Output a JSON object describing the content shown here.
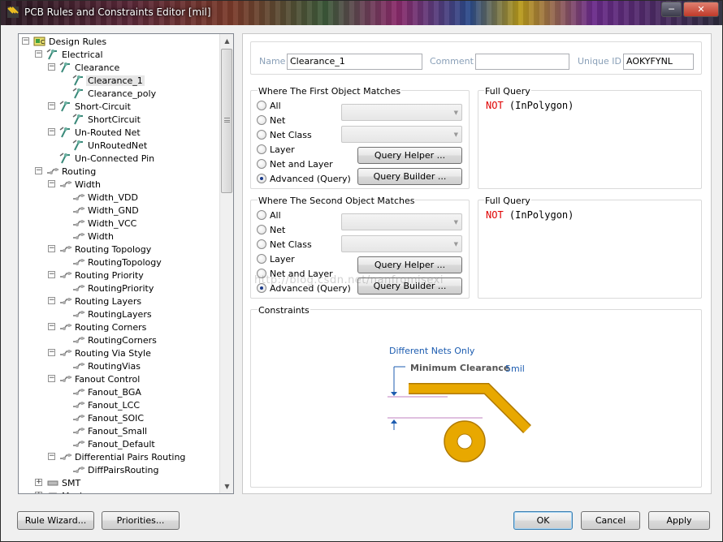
{
  "window": {
    "title": "PCB Rules and Constraints Editor [mil]",
    "minimize_glyph": "─",
    "close_glyph": "✕"
  },
  "tree": {
    "rows": [
      {
        "label": "Design Rules",
        "level": 0,
        "expander": "−",
        "icon": "design-rules-icon"
      },
      {
        "label": "Electrical",
        "level": 1,
        "expander": "−",
        "icon": "electrical-rule-icon"
      },
      {
        "label": "Clearance",
        "level": 2,
        "expander": "−",
        "icon": "electrical-rule-icon"
      },
      {
        "label": "Clearance_1",
        "level": 3,
        "expander": "",
        "icon": "electrical-rule-icon",
        "selected": true
      },
      {
        "label": "Clearance_poly",
        "level": 3,
        "expander": "",
        "icon": "electrical-rule-icon"
      },
      {
        "label": "Short-Circuit",
        "level": 2,
        "expander": "−",
        "icon": "electrical-rule-icon"
      },
      {
        "label": "ShortCircuit",
        "level": 3,
        "expander": "",
        "icon": "electrical-rule-icon"
      },
      {
        "label": "Un-Routed Net",
        "level": 2,
        "expander": "−",
        "icon": "electrical-rule-icon"
      },
      {
        "label": "UnRoutedNet",
        "level": 3,
        "expander": "",
        "icon": "electrical-rule-icon"
      },
      {
        "label": "Un-Connected Pin",
        "level": 2,
        "expander": "",
        "icon": "electrical-rule-icon"
      },
      {
        "label": "Routing",
        "level": 1,
        "expander": "−",
        "icon": "routing-rule-icon"
      },
      {
        "label": "Width",
        "level": 2,
        "expander": "−",
        "icon": "routing-rule-icon"
      },
      {
        "label": "Width_VDD",
        "level": 3,
        "expander": "",
        "icon": "routing-rule-icon"
      },
      {
        "label": "Width_GND",
        "level": 3,
        "expander": "",
        "icon": "routing-rule-icon"
      },
      {
        "label": "Width_VCC",
        "level": 3,
        "expander": "",
        "icon": "routing-rule-icon"
      },
      {
        "label": "Width",
        "level": 3,
        "expander": "",
        "icon": "routing-rule-icon"
      },
      {
        "label": "Routing Topology",
        "level": 2,
        "expander": "−",
        "icon": "routing-rule-icon"
      },
      {
        "label": "RoutingTopology",
        "level": 3,
        "expander": "",
        "icon": "routing-rule-icon"
      },
      {
        "label": "Routing Priority",
        "level": 2,
        "expander": "−",
        "icon": "routing-rule-icon"
      },
      {
        "label": "RoutingPriority",
        "level": 3,
        "expander": "",
        "icon": "routing-rule-icon"
      },
      {
        "label": "Routing Layers",
        "level": 2,
        "expander": "−",
        "icon": "routing-rule-icon"
      },
      {
        "label": "RoutingLayers",
        "level": 3,
        "expander": "",
        "icon": "routing-rule-icon"
      },
      {
        "label": "Routing Corners",
        "level": 2,
        "expander": "−",
        "icon": "routing-rule-icon"
      },
      {
        "label": "RoutingCorners",
        "level": 3,
        "expander": "",
        "icon": "routing-rule-icon"
      },
      {
        "label": "Routing Via Style",
        "level": 2,
        "expander": "−",
        "icon": "routing-rule-icon"
      },
      {
        "label": "RoutingVias",
        "level": 3,
        "expander": "",
        "icon": "routing-rule-icon"
      },
      {
        "label": "Fanout Control",
        "level": 2,
        "expander": "−",
        "icon": "routing-rule-icon"
      },
      {
        "label": "Fanout_BGA",
        "level": 3,
        "expander": "",
        "icon": "routing-rule-icon"
      },
      {
        "label": "Fanout_LCC",
        "level": 3,
        "expander": "",
        "icon": "routing-rule-icon"
      },
      {
        "label": "Fanout_SOIC",
        "level": 3,
        "expander": "",
        "icon": "routing-rule-icon"
      },
      {
        "label": "Fanout_Small",
        "level": 3,
        "expander": "",
        "icon": "routing-rule-icon"
      },
      {
        "label": "Fanout_Default",
        "level": 3,
        "expander": "",
        "icon": "routing-rule-icon"
      },
      {
        "label": "Differential Pairs Routing",
        "level": 2,
        "expander": "−",
        "icon": "routing-rule-icon"
      },
      {
        "label": "DiffPairsRouting",
        "level": 3,
        "expander": "",
        "icon": "routing-rule-icon"
      },
      {
        "label": "SMT",
        "level": 1,
        "expander": "+",
        "icon": "smt-rule-icon"
      },
      {
        "label": "Mask",
        "level": 1,
        "expander": "+",
        "icon": "mask-rule-icon"
      }
    ]
  },
  "header": {
    "name_label": "Name",
    "name_value": "Clearance_1",
    "comment_label": "Comment",
    "comment_value": "",
    "uid_label": "Unique ID",
    "uid_value": "AOKYFYNL"
  },
  "first_match": {
    "title": "Where The First Object Matches",
    "options": [
      "All",
      "Net",
      "Net Class",
      "Layer",
      "Net and Layer",
      "Advanced (Query)"
    ],
    "selected_index": 5,
    "query_helper": "Query Helper ...",
    "query_builder": "Query Builder ..."
  },
  "second_match": {
    "title": "Where The Second Object Matches",
    "options": [
      "All",
      "Net",
      "Net Class",
      "Layer",
      "Net and Layer",
      "Advanced (Query)"
    ],
    "selected_index": 5,
    "query_helper": "Query Helper ...",
    "query_builder": "Query Builder ..."
  },
  "full_query_1": {
    "title": "Full Query",
    "keyword": "NOT",
    "rest": " (InPolygon)"
  },
  "full_query_2": {
    "title": "Full Query",
    "keyword": "NOT",
    "rest": " (InPolygon)"
  },
  "constraints": {
    "title": "Constraints",
    "different_nets": "Different Nets Only",
    "min_clearance": "Minimum Clearance",
    "value": "5mil"
  },
  "watermark": "http://blog.csdn.net/nanfromisexi",
  "footer": {
    "rule_wizard": "Rule Wizard...",
    "priorities": "Priorities...",
    "ok": "OK",
    "cancel": "Cancel",
    "apply": "Apply"
  },
  "colors": {
    "keyword": "#e00000",
    "link_blue": "#1c5cb0",
    "track_gold": "#e8a800"
  }
}
